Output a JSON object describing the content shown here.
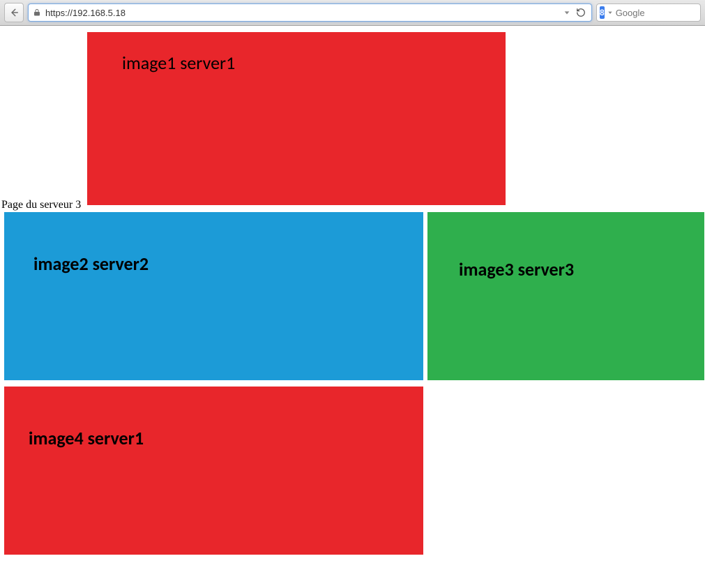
{
  "browser": {
    "url": "https://192.168.5.18",
    "search_placeholder": "Google",
    "search_badge": "8"
  },
  "page": {
    "label": "Page du serveur 3",
    "blocks": {
      "b1": "image1 server1",
      "b2": "image2 server2",
      "b3": "image3 server3",
      "b4": "image4 server1"
    }
  }
}
